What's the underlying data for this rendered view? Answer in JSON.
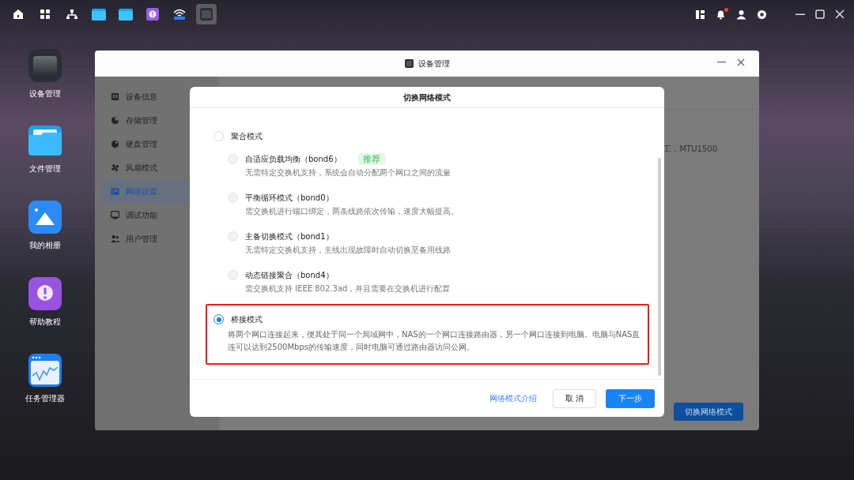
{
  "taskbar": {
    "apps": [
      {
        "kind": "home",
        "selected": false
      },
      {
        "kind": "grid",
        "selected": false
      },
      {
        "kind": "network",
        "selected": false
      },
      {
        "kind": "folder",
        "selected": false
      },
      {
        "kind": "folder",
        "selected": false
      },
      {
        "kind": "help",
        "selected": false
      },
      {
        "kind": "wifi",
        "selected": false
      },
      {
        "kind": "device",
        "selected": true
      }
    ],
    "notification_dot": true
  },
  "desktop_icons": [
    {
      "kind": "device",
      "label": "设备管理"
    },
    {
      "kind": "folder",
      "label": "文件管理"
    },
    {
      "kind": "photo",
      "label": "我的相册"
    },
    {
      "kind": "help",
      "label": "帮助教程"
    },
    {
      "kind": "monitor",
      "label": "任务管理器"
    }
  ],
  "window": {
    "title": "设备管理",
    "sidebar": [
      {
        "kind": "info",
        "label": "设备信息",
        "selected": false
      },
      {
        "kind": "pie",
        "label": "存储管理",
        "selected": false
      },
      {
        "kind": "disk",
        "label": "硬盘管理",
        "selected": false
      },
      {
        "kind": "fan",
        "label": "风扇模式",
        "selected": false
      },
      {
        "kind": "ip",
        "label": "网络设置",
        "selected": true
      },
      {
        "kind": "debug",
        "label": "调试功能",
        "selected": false
      },
      {
        "kind": "users",
        "label": "用户管理",
        "selected": false
      }
    ],
    "background_text": "工，MTU1500",
    "action_button": "切换网络模式"
  },
  "dialog": {
    "title": "切换网络模式",
    "options": [
      {
        "label": "聚合模式",
        "selected": false,
        "children": [
          {
            "label": "自适应负载均衡（bond6）",
            "badge": "推荐",
            "description": "无需特定交换机支持，系统会自动分配两个网口之间的流量",
            "selected": false
          },
          {
            "label": "平衡循环模式（bond0）",
            "description": "需交换机进行端口绑定，两条线路依次传输，速度大幅提高。",
            "selected": false
          },
          {
            "label": "主备切换模式（bond1）",
            "description": "无需特定交换机支持，主线出现故障时自动切换至备用线路",
            "selected": false
          },
          {
            "label": "动态链接聚合（bond4）",
            "description": "需交换机支持 IEEE 802.3ad，并且需要在交换机进行配置",
            "selected": false
          }
        ]
      },
      {
        "label": "桥接模式",
        "selected": true,
        "annotated": true,
        "description": "将两个网口连接起来，便其处于同一个局域网中，NAS的一个网口连接路由器，另一个网口连接到电脑。电脑与NAS直连可以达到2500Mbps的传输速度，同时电脑可通过路由器访问公网。"
      }
    ],
    "link": "网络模式介绍",
    "cancel_button": "取 消",
    "next_button": "下一步"
  }
}
